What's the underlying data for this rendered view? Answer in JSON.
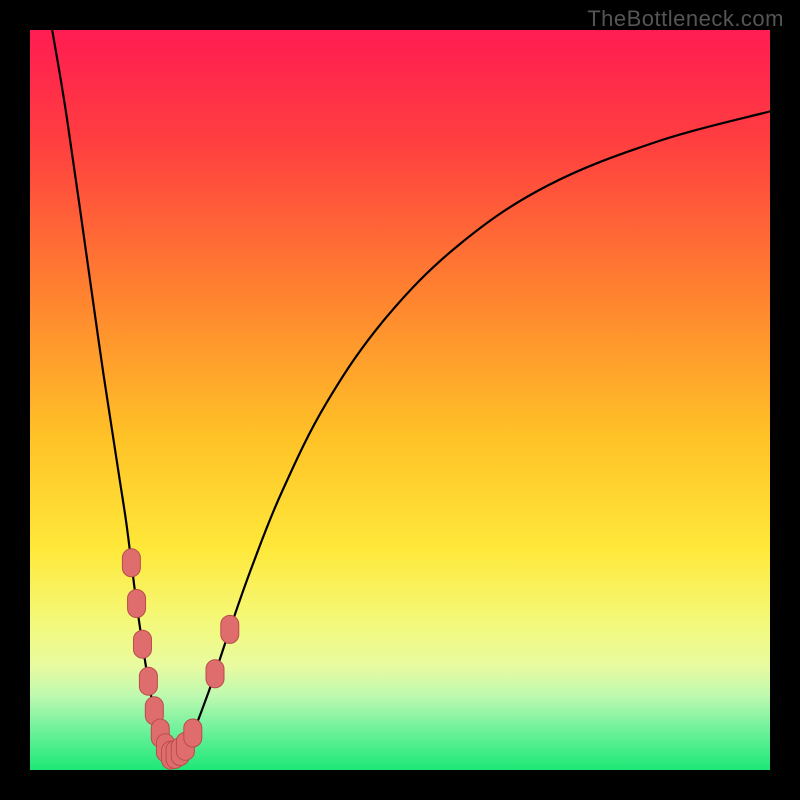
{
  "watermark": "TheBottleneck.com",
  "colors": {
    "background_black": "#000000",
    "curve_stroke": "#000000",
    "marker_fill": "#DF6D6D",
    "marker_stroke": "#B94C4C",
    "gradient_stops": [
      {
        "offset": 0.0,
        "color": "#FF1C52"
      },
      {
        "offset": 0.15,
        "color": "#FF3E40"
      },
      {
        "offset": 0.35,
        "color": "#FF8030"
      },
      {
        "offset": 0.55,
        "color": "#FFC227"
      },
      {
        "offset": 0.7,
        "color": "#FFE83A"
      },
      {
        "offset": 0.8,
        "color": "#F4F97A"
      },
      {
        "offset": 0.86,
        "color": "#E8FBA0"
      },
      {
        "offset": 0.9,
        "color": "#BEF9B0"
      },
      {
        "offset": 0.94,
        "color": "#78F29E"
      },
      {
        "offset": 1.0,
        "color": "#1CE876"
      }
    ]
  },
  "chart_data": {
    "type": "line",
    "title": "",
    "xlabel": "",
    "ylabel": "",
    "xlim": [
      0,
      100
    ],
    "ylim": [
      0,
      100
    ],
    "minimum_x": 19,
    "series": [
      {
        "name": "bottleneck-v-curve",
        "points": [
          {
            "x": 3.0,
            "y": 100.0
          },
          {
            "x": 5.0,
            "y": 88.0
          },
          {
            "x": 8.0,
            "y": 67.0
          },
          {
            "x": 10.0,
            "y": 53.0
          },
          {
            "x": 12.0,
            "y": 40.0
          },
          {
            "x": 13.0,
            "y": 33.5
          },
          {
            "x": 13.7,
            "y": 28.0
          },
          {
            "x": 14.4,
            "y": 22.5
          },
          {
            "x": 15.2,
            "y": 17.0
          },
          {
            "x": 16.0,
            "y": 12.0
          },
          {
            "x": 16.8,
            "y": 8.0
          },
          {
            "x": 17.6,
            "y": 5.0
          },
          {
            "x": 18.3,
            "y": 3.0
          },
          {
            "x": 19.0,
            "y": 2.0
          },
          {
            "x": 20.0,
            "y": 2.2
          },
          {
            "x": 21.0,
            "y": 3.2
          },
          {
            "x": 22.0,
            "y": 5.0
          },
          {
            "x": 23.2,
            "y": 8.0
          },
          {
            "x": 25.0,
            "y": 13.0
          },
          {
            "x": 27.0,
            "y": 19.0
          },
          {
            "x": 30.0,
            "y": 27.5
          },
          {
            "x": 34.0,
            "y": 37.5
          },
          {
            "x": 40.0,
            "y": 49.5
          },
          {
            "x": 48.0,
            "y": 61.0
          },
          {
            "x": 58.0,
            "y": 71.0
          },
          {
            "x": 70.0,
            "y": 79.0
          },
          {
            "x": 85.0,
            "y": 85.0
          },
          {
            "x": 100.0,
            "y": 89.0
          }
        ]
      }
    ],
    "markers": [
      {
        "x": 13.7,
        "y": 28.0
      },
      {
        "x": 14.4,
        "y": 22.5
      },
      {
        "x": 15.2,
        "y": 17.0
      },
      {
        "x": 16.0,
        "y": 12.0
      },
      {
        "x": 16.8,
        "y": 8.0
      },
      {
        "x": 17.6,
        "y": 5.0
      },
      {
        "x": 18.3,
        "y": 3.0
      },
      {
        "x": 19.0,
        "y": 2.0
      },
      {
        "x": 19.6,
        "y": 2.1
      },
      {
        "x": 20.3,
        "y": 2.5
      },
      {
        "x": 21.0,
        "y": 3.2
      },
      {
        "x": 22.0,
        "y": 5.0
      },
      {
        "x": 25.0,
        "y": 13.0
      },
      {
        "x": 27.0,
        "y": 19.0
      }
    ]
  }
}
